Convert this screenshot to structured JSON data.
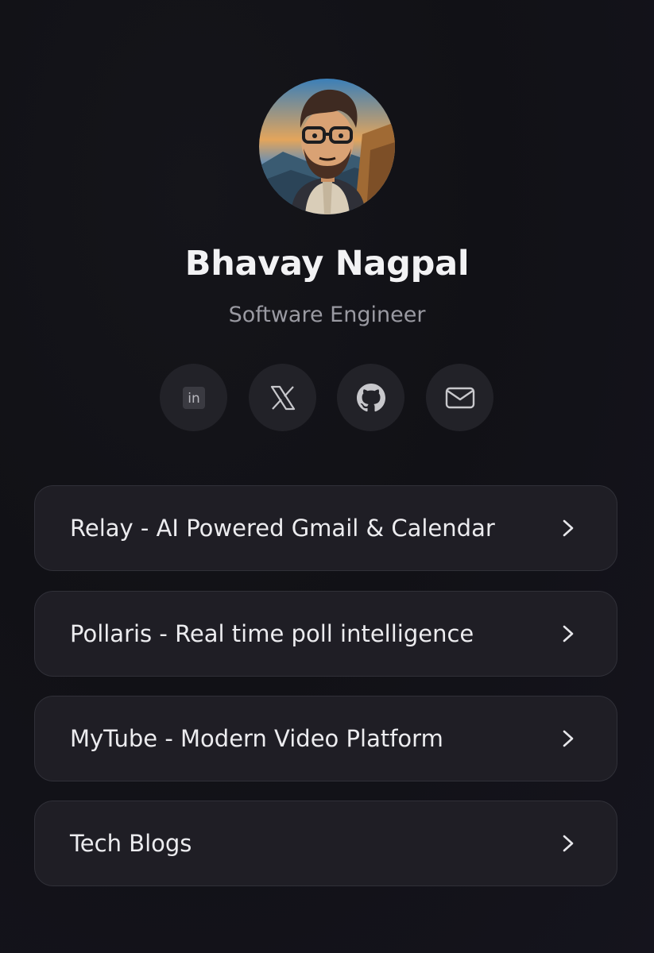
{
  "profile": {
    "name": "Bhavay Nagpal",
    "title": "Software Engineer",
    "avatar_icon": "avatar-illustration"
  },
  "socials": [
    {
      "icon": "linkedin-icon",
      "label": "in"
    },
    {
      "icon": "x-twitter-icon"
    },
    {
      "icon": "github-icon"
    },
    {
      "icon": "mail-icon"
    }
  ],
  "links": [
    {
      "label": "Relay - AI Powered Gmail & Calendar",
      "icon": "chevron-right-icon"
    },
    {
      "label": "Pollaris - Real time poll intelligence",
      "icon": "chevron-right-icon"
    },
    {
      "label": "MyTube - Modern Video Platform",
      "icon": "chevron-right-icon"
    },
    {
      "label": "Tech Blogs",
      "icon": "chevron-right-icon"
    }
  ],
  "colors": {
    "background": "#121217",
    "card": "#1f1e25",
    "card_border": "#303038",
    "social_bg": "#222228",
    "text_primary": "#f2f2f4",
    "text_secondary": "#9a9aa2"
  }
}
